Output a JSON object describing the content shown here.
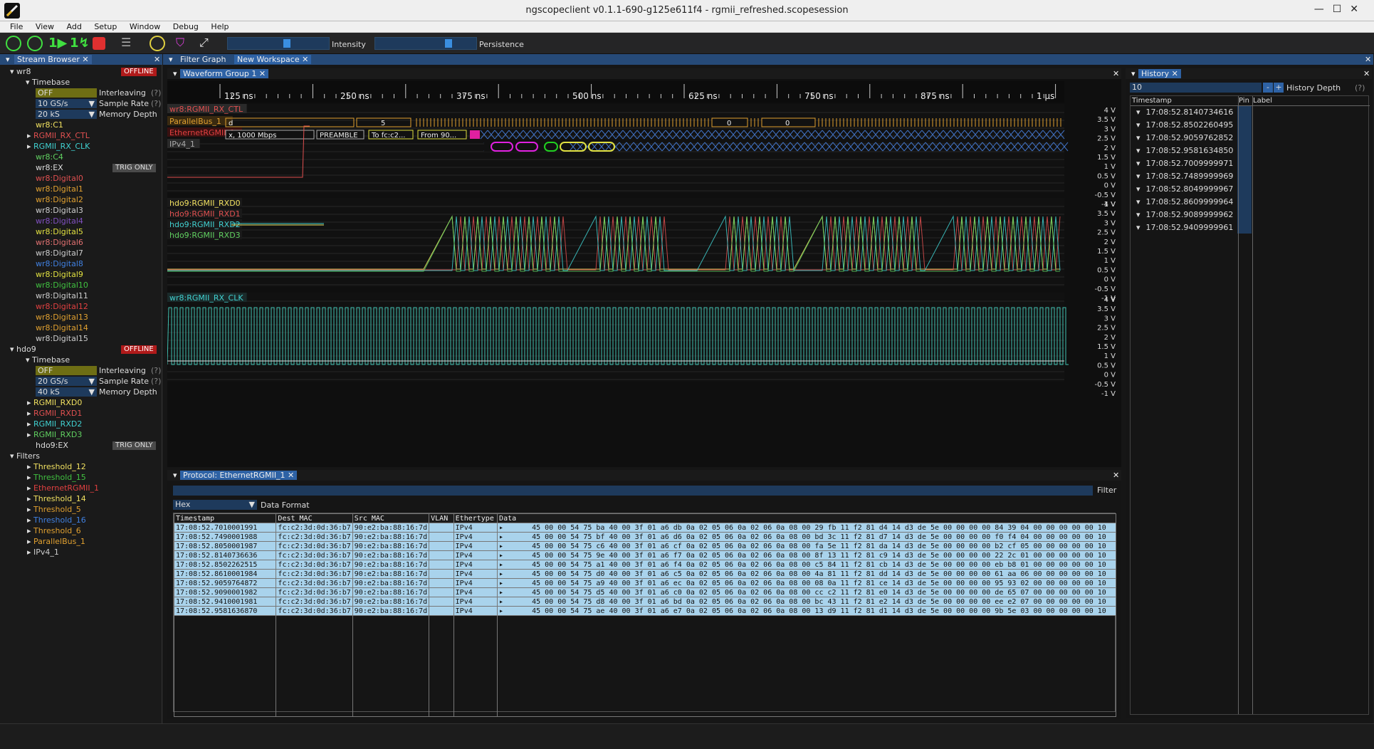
{
  "window": {
    "title": "ngscopeclient v0.1.1-690-g125e611f4 - rgmii_refreshed.scopesession"
  },
  "menu": [
    "File",
    "View",
    "Add",
    "Setup",
    "Window",
    "Debug",
    "Help"
  ],
  "toolbar": {
    "intensity_label": "Intensity",
    "persistence_label": "Persistence",
    "intensity_level": 0.6,
    "persistence_level": 0.75
  },
  "stream_browser": {
    "tab": "Stream Browser",
    "wr8": {
      "name": "wr8",
      "status": "OFFLINE",
      "timebase": "Timebase",
      "interleaving_value": "OFF",
      "interleaving_label": "Interleaving",
      "sample_rate_value": "10 GS/s",
      "sample_rate_label": "Sample Rate",
      "memory_depth_value": "20 kS",
      "memory_depth_label": "Memory Depth",
      "channels": [
        {
          "name": "wr8:C1",
          "color": "#f0e060"
        },
        {
          "name": "RGMII_RX_CTL",
          "color": "#e05050"
        },
        {
          "name": "RGMII_RX_CLK",
          "color": "#40d0d0"
        },
        {
          "name": "wr8:C4",
          "color": "#60d060"
        },
        {
          "name": "wr8:EX",
          "color": "#dddddd"
        },
        {
          "name": "wr8:Digital0",
          "color": "#e05050"
        },
        {
          "name": "wr8:Digital1",
          "color": "#e0a030"
        },
        {
          "name": "wr8:Digital2",
          "color": "#e0a030"
        },
        {
          "name": "wr8:Digital3",
          "color": "#cccccc"
        },
        {
          "name": "wr8:Digital4",
          "color": "#8050c0"
        },
        {
          "name": "wr8:Digital5",
          "color": "#e0e040"
        },
        {
          "name": "wr8:Digital6",
          "color": "#e07070"
        },
        {
          "name": "wr8:Digital7",
          "color": "#cccccc"
        },
        {
          "name": "wr8:Digital8",
          "color": "#4080e0"
        },
        {
          "name": "wr8:Digital9",
          "color": "#e0e040"
        },
        {
          "name": "wr8:Digital10",
          "color": "#40c040"
        },
        {
          "name": "wr8:Digital11",
          "color": "#cccccc"
        },
        {
          "name": "wr8:Digital12",
          "color": "#e04040"
        },
        {
          "name": "wr8:Digital13",
          "color": "#e0a030"
        },
        {
          "name": "wr8:Digital14",
          "color": "#e0a030"
        },
        {
          "name": "wr8:Digital15",
          "color": "#cccccc"
        }
      ],
      "trig_only": "TRIG ONLY"
    },
    "hdo9": {
      "name": "hdo9",
      "status": "OFFLINE",
      "timebase": "Timebase",
      "interleaving_value": "OFF",
      "interleaving_label": "Interleaving",
      "sample_rate_value": "20 GS/s",
      "sample_rate_label": "Sample Rate",
      "memory_depth_value": "40 kS",
      "memory_depth_label": "Memory Depth",
      "channels": [
        {
          "name": "RGMII_RXD0",
          "color": "#f0e060"
        },
        {
          "name": "RGMII_RXD1",
          "color": "#e05050"
        },
        {
          "name": "RGMII_RXD2",
          "color": "#40d0d0"
        },
        {
          "name": "RGMII_RXD3",
          "color": "#60d060"
        },
        {
          "name": "hdo9:EX",
          "color": "#dddddd"
        }
      ],
      "trig_only": "TRIG ONLY"
    },
    "filters_label": "Filters",
    "filters": [
      {
        "name": "Threshold_12",
        "color": "#f0e060"
      },
      {
        "name": "Threshold_15",
        "color": "#40c040"
      },
      {
        "name": "EthernetRGMII_1",
        "color": "#e04040"
      },
      {
        "name": "Threshold_14",
        "color": "#f0e060"
      },
      {
        "name": "Threshold_5",
        "color": "#e0a030"
      },
      {
        "name": "Threshold_16",
        "color": "#4080e0"
      },
      {
        "name": "Threshold_6",
        "color": "#e0a030"
      },
      {
        "name": "ParallelBus_1",
        "color": "#e0a030"
      },
      {
        "name": "IPv4_1",
        "color": "#cccccc"
      }
    ]
  },
  "tabs": {
    "filter_graph": "Filter Graph",
    "new_workspace": "New Workspace",
    "waveform_group": "Waveform Group 1",
    "history": "History",
    "protocol": "Protocol: EthernetRGMII_1"
  },
  "timeline": [
    "125 ns",
    "250 ns",
    "375 ns",
    "500 ns",
    "625 ns",
    "750 ns",
    "875 ns",
    "1 µs"
  ],
  "volt_labels": [
    "4 V",
    "3.5 V",
    "3 V",
    "2.5 V",
    "2 V",
    "1.5 V",
    "1 V",
    "0.5 V",
    "0 V",
    "-0.5 V",
    "-1 V"
  ],
  "area1": {
    "channel": "wr8:RGMII_RX_CTL",
    "parallel": "ParallelBus_1",
    "parallel_vals": [
      "d",
      "5",
      "0",
      "0"
    ],
    "ethernet": "EthernetRGMII_1",
    "eth_vals": [
      "x, 1000 Mbps",
      "PREAMBLE",
      "To fc:c2...",
      "From 90..."
    ],
    "ipv4": "IPv4_1"
  },
  "area2": {
    "channels": [
      "hdo9:RGMII_RXD0",
      "hdo9:RGMII_RXD1",
      "hdo9:RGMII_RXD2",
      "hdo9:RGMII_RXD3"
    ]
  },
  "area3": {
    "channel": "wr8:RGMII_RX_CLK"
  },
  "history": {
    "depth_value": "10",
    "depth_label": "History Depth",
    "q": "(?)",
    "col_timestamp": "Timestamp",
    "col_pin": "Pin",
    "col_label": "Label",
    "rows": [
      "17:08:52.8140734616",
      "17:08:52.8502260495",
      "17:08:52.9059762852",
      "17:08:52.9581634850",
      "17:08:52.7009999971",
      "17:08:52.7489999969",
      "17:08:52.8049999967",
      "17:08:52.8609999964",
      "17:08:52.9089999962",
      "17:08:52.9409999961"
    ]
  },
  "protocol": {
    "filter_label": "Filter",
    "format_value": "Hex",
    "format_label": "Data Format",
    "columns": [
      "Timestamp",
      "Dest MAC",
      "Src MAC",
      "VLAN",
      "Ethertype",
      "Data"
    ],
    "rows": [
      {
        "ts": "17:08:52.7010001991",
        "dst": "fc:c2:3d:0d:36:b7",
        "src": "90:e2:ba:88:16:7d",
        "vlan": "",
        "et": "IPv4",
        "data": "45 00 00 54 75 ba 40 00 3f 01 a6 db 0a 02 05 06 0a 02 06 0a 08 00 29 fb 11 f2 81 d4 14 d3 de 5e 00 00 00 00 84 39 04 00 00 00 00 00 10"
      },
      {
        "ts": "17:08:52.7490001988",
        "dst": "fc:c2:3d:0d:36:b7",
        "src": "90:e2:ba:88:16:7d",
        "vlan": "",
        "et": "IPv4",
        "data": "45 00 00 54 75 bf 40 00 3f 01 a6 d6 0a 02 05 06 0a 02 06 0a 08 00 bd 3c 11 f2 81 d7 14 d3 de 5e 00 00 00 00 f0 f4 04 00 00 00 00 00 10"
      },
      {
        "ts": "17:08:52.8050001987",
        "dst": "fc:c2:3d:0d:36:b7",
        "src": "90:e2:ba:88:16:7d",
        "vlan": "",
        "et": "IPv4",
        "data": "45 00 00 54 75 c6 40 00 3f 01 a6 cf 0a 02 05 06 0a 02 06 0a 08 00 fa 5e 11 f2 81 da 14 d3 de 5e 00 00 00 00 b2 cf 05 00 00 00 00 00 10"
      },
      {
        "ts": "17:08:52.8140736636",
        "dst": "fc:c2:3d:0d:36:b7",
        "src": "90:e2:ba:88:16:7d",
        "vlan": "",
        "et": "IPv4",
        "data": "45 00 00 54 75 9e 40 00 3f 01 a6 f7 0a 02 05 06 0a 02 06 0a 08 00 8f 13 11 f2 81 c9 14 d3 de 5e 00 00 00 00 22 2c 01 00 00 00 00 00 10"
      },
      {
        "ts": "17:08:52.8502262515",
        "dst": "fc:c2:3d:0d:36:b7",
        "src": "90:e2:ba:88:16:7d",
        "vlan": "",
        "et": "IPv4",
        "data": "45 00 00 54 75 a1 40 00 3f 01 a6 f4 0a 02 05 06 0a 02 06 0a 08 00 c5 84 11 f2 81 cb 14 d3 de 5e 00 00 00 00 eb b8 01 00 00 00 00 00 10"
      },
      {
        "ts": "17:08:52.8610001984",
        "dst": "fc:c2:3d:0d:36:b7",
        "src": "90:e2:ba:88:16:7d",
        "vlan": "",
        "et": "IPv4",
        "data": "45 00 00 54 75 d0 40 00 3f 01 a6 c5 0a 02 05 06 0a 02 06 0a 08 00 4a 81 11 f2 81 dd 14 d3 de 5e 00 00 00 00 61 aa 06 00 00 00 00 00 10"
      },
      {
        "ts": "17:08:52.9059764872",
        "dst": "fc:c2:3d:0d:36:b7",
        "src": "90:e2:ba:88:16:7d",
        "vlan": "",
        "et": "IPv4",
        "data": "45 00 00 54 75 a9 40 00 3f 01 a6 ec 0a 02 05 06 0a 02 06 0a 08 00 08 0a 11 f2 81 ce 14 d3 de 5e 00 00 00 00 95 93 02 00 00 00 00 00 10"
      },
      {
        "ts": "17:08:52.9090001982",
        "dst": "fc:c2:3d:0d:36:b7",
        "src": "90:e2:ba:88:16:7d",
        "vlan": "",
        "et": "IPv4",
        "data": "45 00 00 54 75 d5 40 00 3f 01 a6 c0 0a 02 05 06 0a 02 06 0a 08 00 cc c2 11 f2 81 e0 14 d3 de 5e 00 00 00 00 de 65 07 00 00 00 00 00 10"
      },
      {
        "ts": "17:08:52.9410001981",
        "dst": "fc:c2:3d:0d:36:b7",
        "src": "90:e2:ba:88:16:7d",
        "vlan": "",
        "et": "IPv4",
        "data": "45 00 00 54 75 d8 40 00 3f 01 a6 bd 0a 02 05 06 0a 02 06 0a 08 00 bc 43 11 f2 81 e2 14 d3 de 5e 00 00 00 00 ee e2 07 00 00 00 00 00 10"
      },
      {
        "ts": "17:08:52.9581636870",
        "dst": "fc:c2:3d:0d:36:b7",
        "src": "90:e2:ba:88:16:7d",
        "vlan": "",
        "et": "IPv4",
        "data": "45 00 00 54 75 ae 40 00 3f 01 a6 e7 0a 02 05 06 0a 02 06 0a 08 00 13 d9 11 f2 81 d1 14 d3 de 5e 00 00 00 00 9b 5e 03 00 00 00 00 00 10"
      }
    ]
  }
}
